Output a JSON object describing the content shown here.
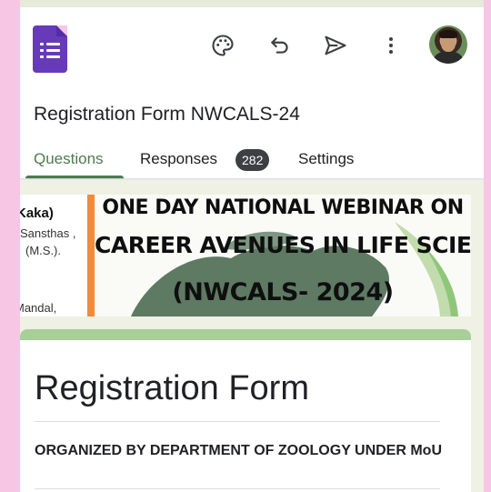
{
  "header": {
    "app_icon": "google-forms-icon",
    "actions": [
      {
        "name": "palette-icon"
      },
      {
        "name": "undo-icon"
      },
      {
        "name": "send-icon"
      },
      {
        "name": "more-vert-icon"
      }
    ],
    "avatar": "avatar"
  },
  "form": {
    "title": "Registration Form NWCALS-24"
  },
  "tabs": {
    "questions": "Questions",
    "responses": "Responses",
    "responses_count": "282",
    "settings": "Settings"
  },
  "banner": {
    "left_text": [
      "Kaka)",
      "Sansthas ,",
      "(M.S.).",
      "Mandal,"
    ],
    "line1": "ONE DAY NATIONAL WEBINAR ON",
    "line2": "CAREER AVENUES IN LIFE SCIENCE",
    "line3": "(NWCALS- 2024)"
  },
  "card": {
    "heading": "Registration Form",
    "description": "ORGANIZED BY DEPARTMENT OF ZOOLOGY UNDER MoU"
  },
  "colors": {
    "brand_purple": "#673ab7",
    "accent_green": "#4d7b4f",
    "card_header": "#a7cf97",
    "background_pink": "#f7c6e4"
  }
}
